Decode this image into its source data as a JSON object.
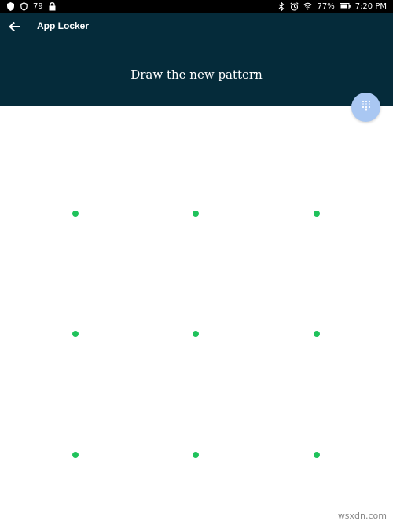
{
  "status_bar": {
    "notif_number": "79",
    "battery": "77%",
    "time": "7:20 PM",
    "icons_left": [
      "shield-icon",
      "shield-outline-icon",
      "notification-count",
      "lock-icon"
    ],
    "icons_right": [
      "bluetooth-icon",
      "alarm-icon",
      "wifi-icon",
      "battery-icon"
    ]
  },
  "app_bar": {
    "title": "App Locker",
    "back_icon": "arrow-left-icon",
    "prompt": "Draw the new pattern"
  },
  "fab": {
    "icon": "dialpad-icon"
  },
  "pattern": {
    "rows": 3,
    "cols": 3,
    "dot_color": "#1fc25b"
  },
  "colors": {
    "app_bar_bg": "#052b3a",
    "fab_bg": "#a9c7f2",
    "status_bar_bg": "#000000"
  },
  "watermark": "wsxdn.com"
}
